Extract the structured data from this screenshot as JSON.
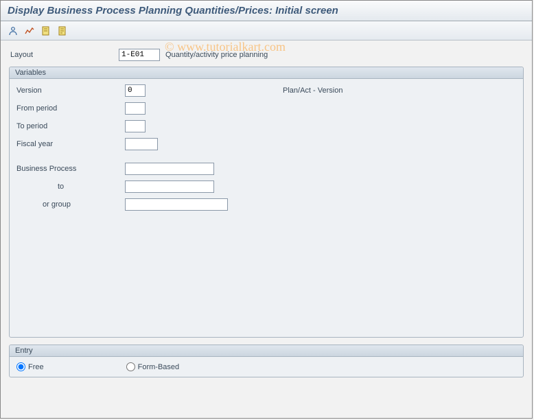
{
  "title": "Display Business Process Planning Quantities/Prices: Initial screen",
  "watermark": "© www.tutorialkart.com",
  "toolbar": {
    "icons": [
      "user-profile-icon",
      "overview-icon",
      "document-icon",
      "document-alt-icon"
    ]
  },
  "layout": {
    "label": "Layout",
    "value": "1-E01",
    "desc": "Quantity/activity price planning"
  },
  "variables": {
    "title": "Variables",
    "version": {
      "label": "Version",
      "value": "0",
      "desc": "Plan/Act - Version"
    },
    "from_period": {
      "label": "From period",
      "value": ""
    },
    "to_period": {
      "label": "To period",
      "value": ""
    },
    "fiscal_year": {
      "label": "Fiscal year",
      "value": ""
    },
    "business_process": {
      "label": "Business Process",
      "value": ""
    },
    "bp_to": {
      "label": "to",
      "value": ""
    },
    "bp_group": {
      "label": "or group",
      "value": ""
    }
  },
  "entry": {
    "title": "Entry",
    "free": "Free",
    "form_based": "Form-Based",
    "selected": "free"
  }
}
